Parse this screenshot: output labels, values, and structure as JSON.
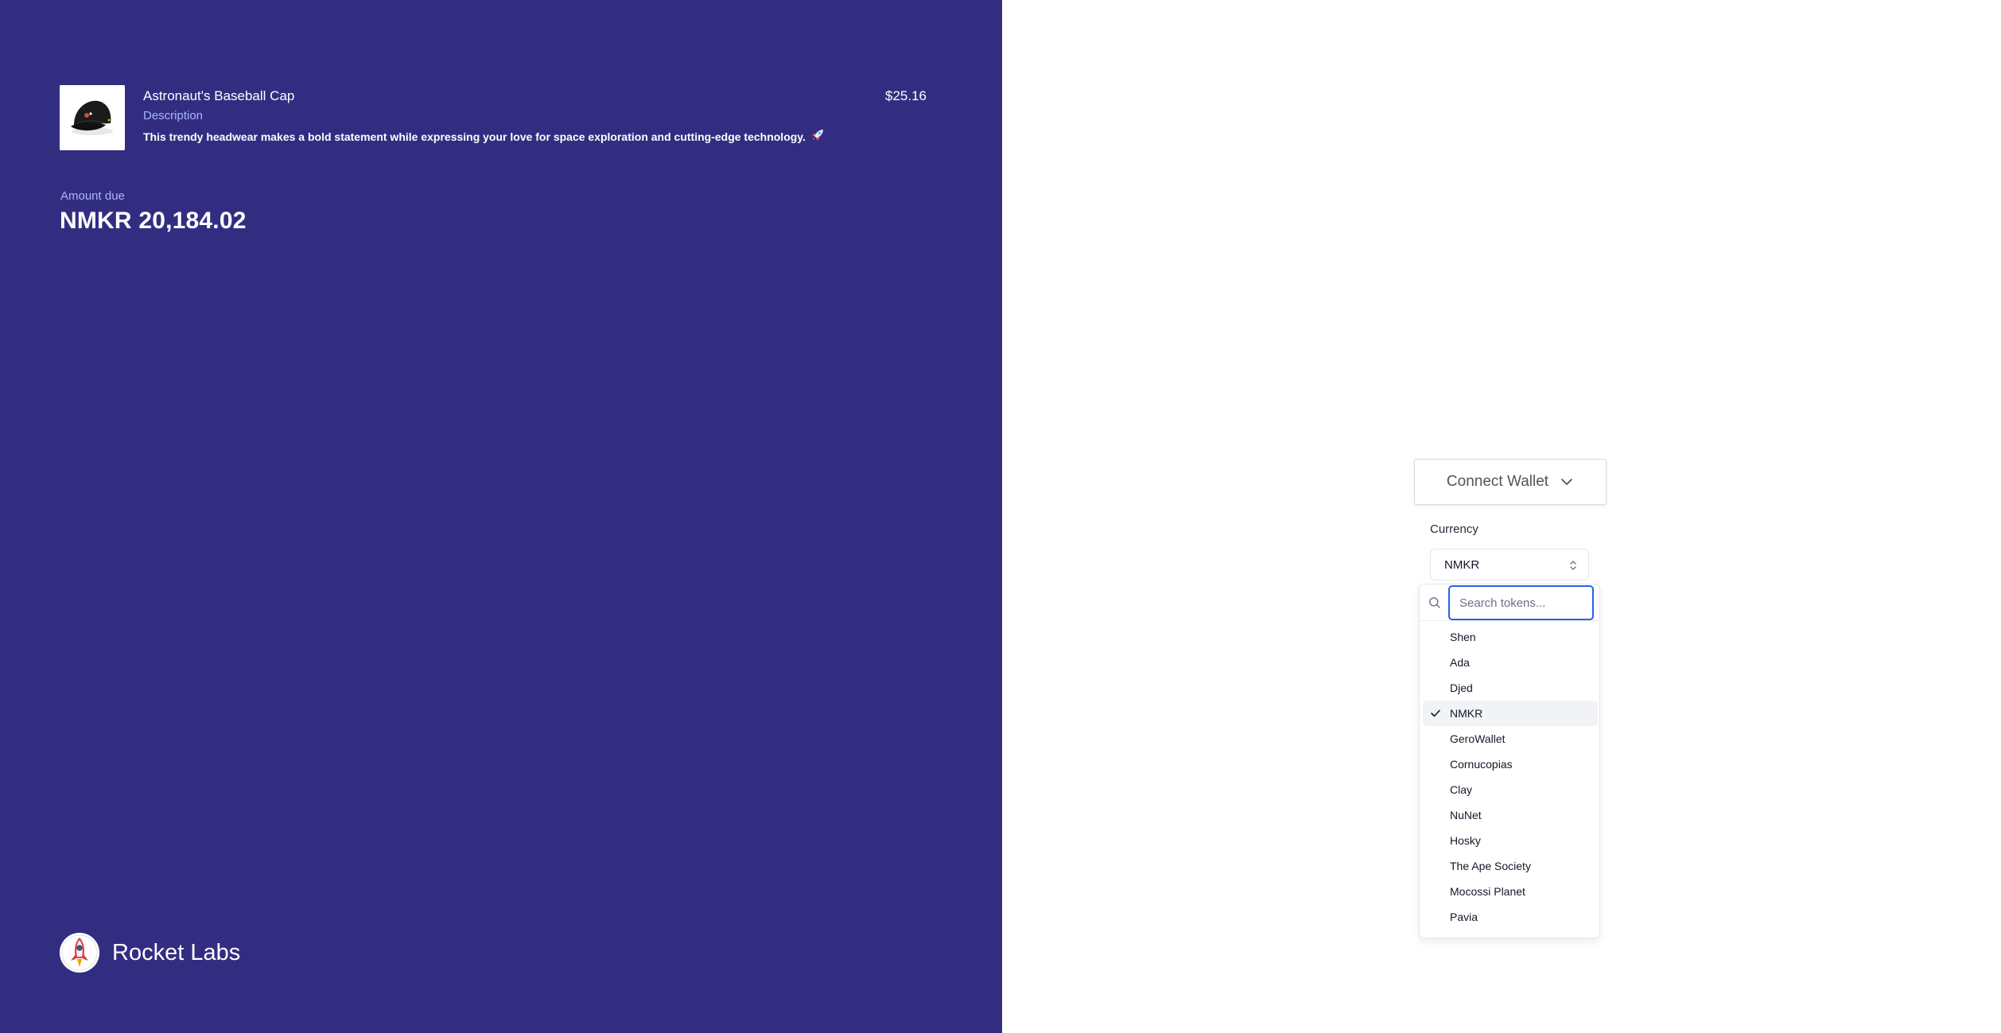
{
  "product": {
    "name": "Astronaut's Baseball Cap",
    "description_label": "Description",
    "description": "This trendy headwear makes a bold statement while expressing your love for space exploration and cutting-edge technology.",
    "price": "$25.16",
    "image_icon": "baseball-cap-image"
  },
  "amount": {
    "label": "Amount due",
    "value": "NMKR 20,184.02"
  },
  "brand": {
    "name": "Rocket Labs",
    "logo_icon": "rocket-icon"
  },
  "wallet": {
    "connect_label": "Connect Wallet"
  },
  "currency": {
    "label": "Currency",
    "selected": "NMKR",
    "search_placeholder": "Search tokens...",
    "options": [
      "Shen",
      "Ada",
      "Djed",
      "NMKR",
      "GeroWallet",
      "Cornucopias",
      "Clay",
      "NuNet",
      "Hosky",
      "The Ape Society",
      "Mocossi Planet",
      "Pavia"
    ]
  },
  "colors": {
    "left_panel": "#332d82",
    "muted_label": "#a9b5ff",
    "focus_ring": "#2563eb"
  }
}
